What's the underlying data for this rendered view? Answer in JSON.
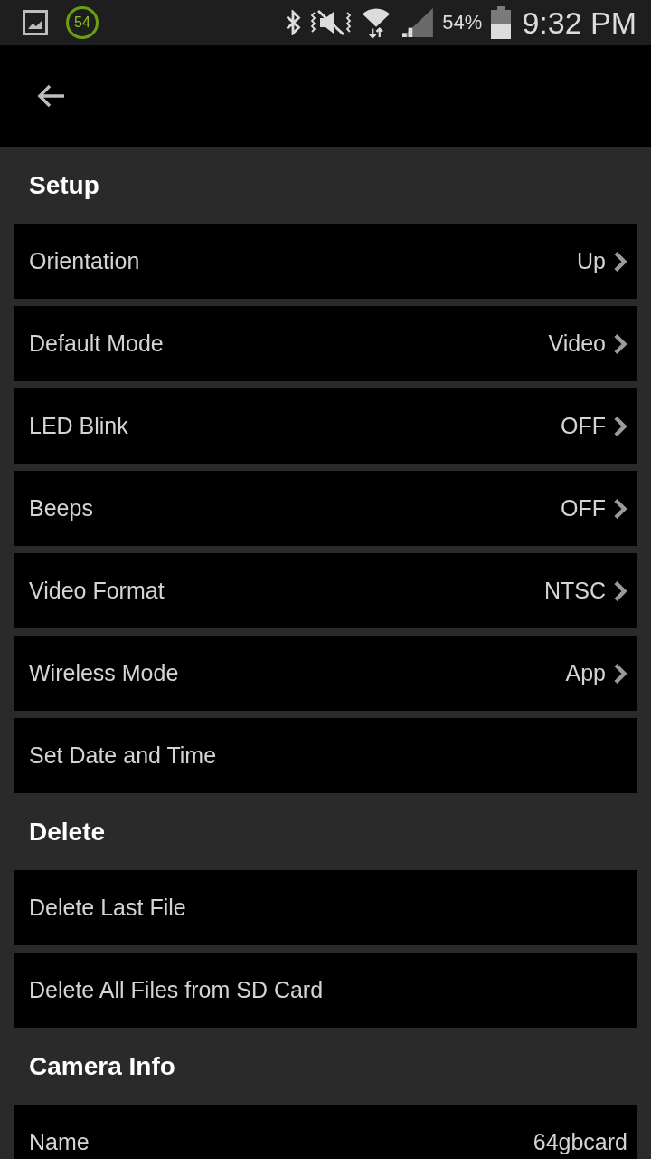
{
  "status_bar": {
    "notification_badge": "54",
    "battery_percent": "54%",
    "time": "9:32 PM"
  },
  "sections": [
    {
      "title": "Setup",
      "items": [
        {
          "label": "Orientation",
          "value": "Up",
          "kind": "choice"
        },
        {
          "label": "Default Mode",
          "value": "Video",
          "kind": "choice"
        },
        {
          "label": "LED Blink",
          "value": "OFF",
          "kind": "choice"
        },
        {
          "label": "Beeps",
          "value": "OFF",
          "kind": "choice"
        },
        {
          "label": "Video Format",
          "value": "NTSC",
          "kind": "choice"
        },
        {
          "label": "Wireless Mode",
          "value": "App",
          "kind": "choice"
        },
        {
          "label": "Set Date and Time",
          "kind": "action"
        }
      ]
    },
    {
      "title": "Delete",
      "items": [
        {
          "label": "Delete Last File",
          "kind": "action"
        },
        {
          "label": "Delete All Files from SD Card",
          "kind": "action"
        }
      ]
    },
    {
      "title": "Camera Info",
      "items": [
        {
          "label": "Name",
          "value": "64gbcard",
          "kind": "info"
        }
      ]
    }
  ]
}
